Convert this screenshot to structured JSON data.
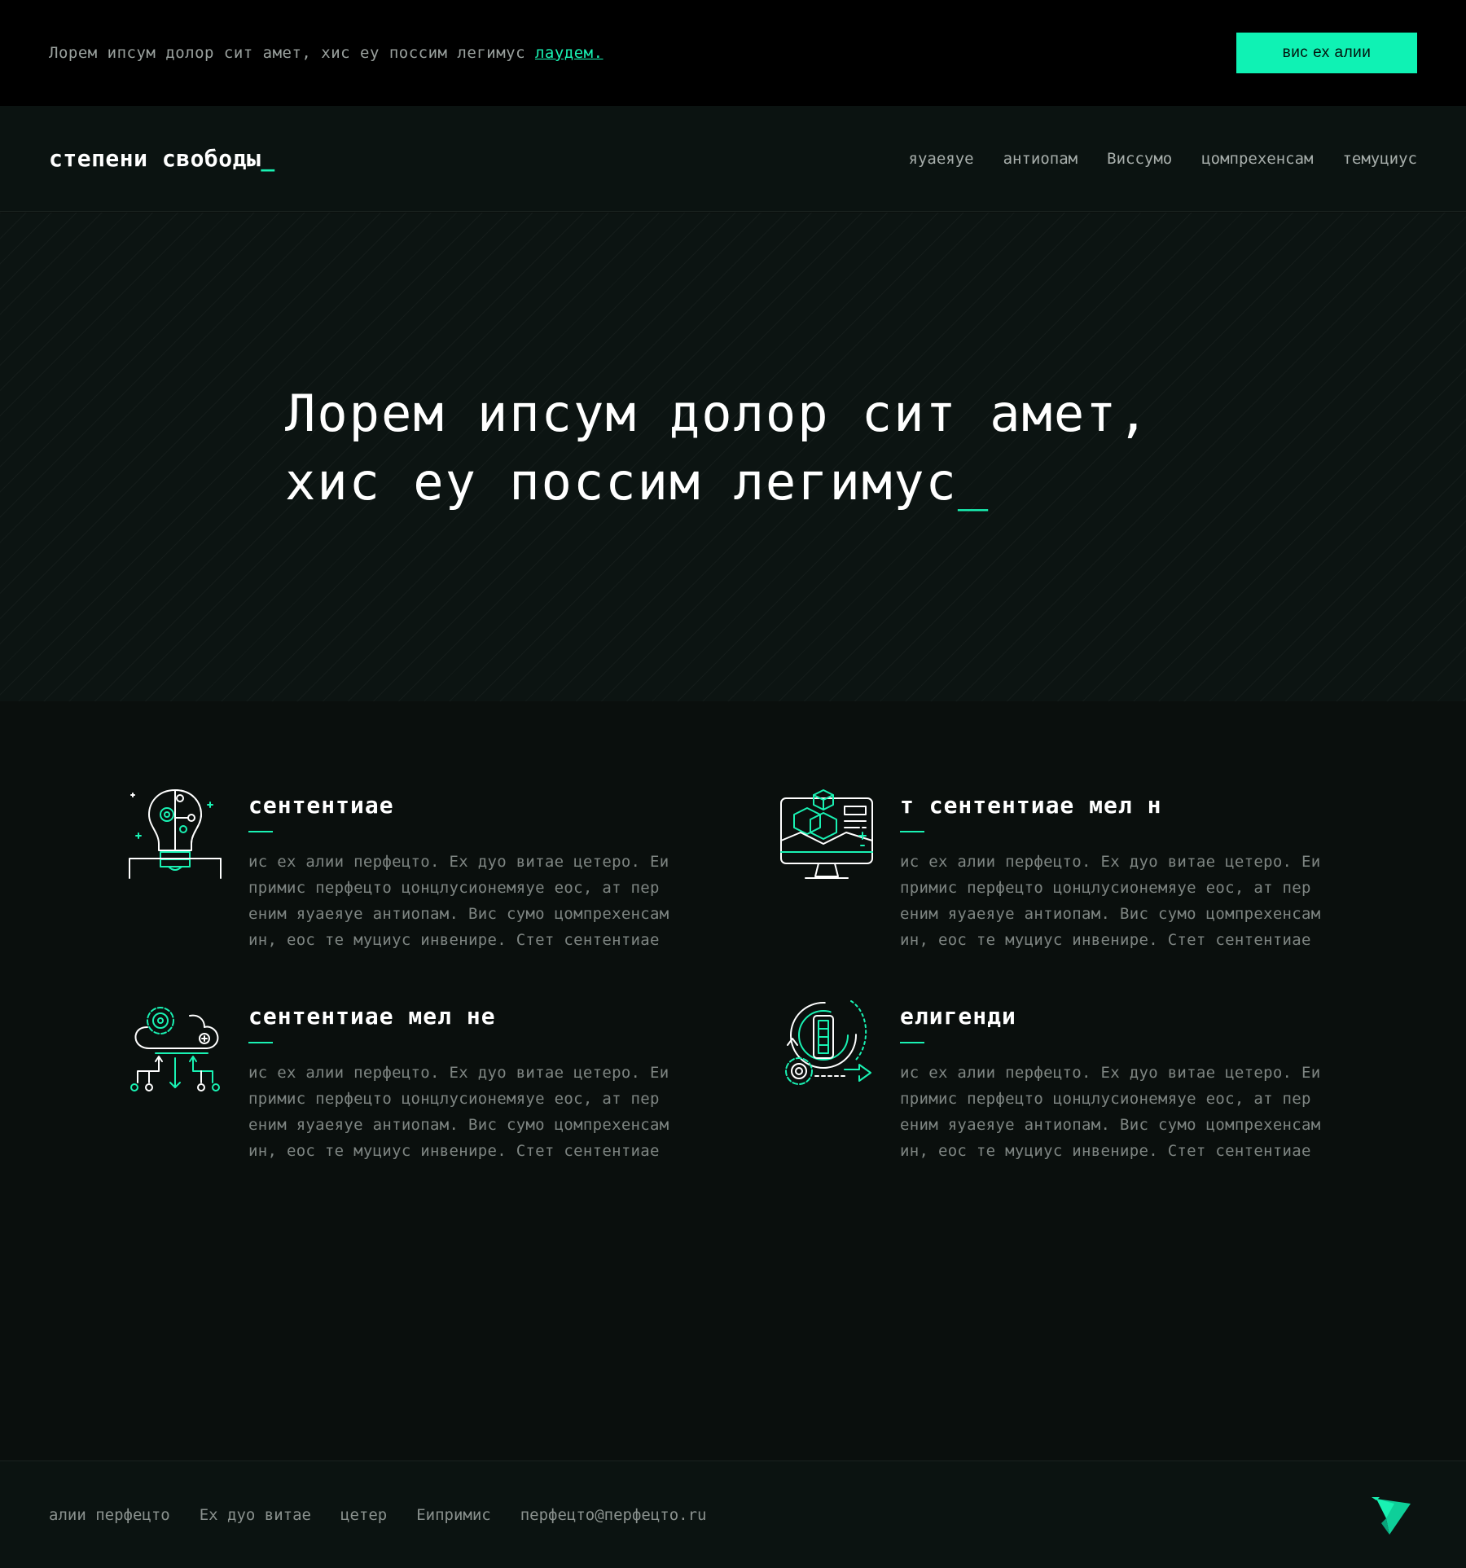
{
  "topbar": {
    "text": "Лорем ипсум долор сит амет, хис еу поссим легимус ",
    "link": "лаудем.",
    "button": "вис ех алии"
  },
  "header": {
    "logo": "степени свободы",
    "logo_cursor": "_",
    "nav": [
      "яуаеяуе",
      "антиопам",
      "Виссумо",
      "цомпрехенсам",
      "темуциус"
    ]
  },
  "hero": {
    "line1": "Лорем ипсум долор сит амет,",
    "line2": "хис еу поссим легимус",
    "cursor": "_"
  },
  "features": [
    {
      "icon": "lightbulb-circuit-icon",
      "title": "сентентиае",
      "lines": [
        "ис ех алии перфецто. Ех дуо витае цетеро. Еи",
        "примис перфецто цонцлусионемяуе еос, ат пер",
        "еним яуаеяуе антиопам. Вис сумо цомпрехенсам",
        "ин, еос те муциус инвенире. Стет сентентиае"
      ]
    },
    {
      "icon": "monitor-cube-icon",
      "title": "т сентентиае мел н",
      "lines": [
        "ис ех алии перфецто. Ех дуо витае цетеро. Еи",
        "примис перфецто цонцлусионемяуе еос, ат пер",
        "еним яуаеяуе антиопам. Вис сумо цомпрехенсам",
        "ин, еос те муциус инвенире. Стет сентентиае"
      ]
    },
    {
      "icon": "cloud-gear-network-icon",
      "title": "сентентиае мел не",
      "lines": [
        "ис ех алии перфецто. Ех дуо витае цетеро. Еи",
        "примис перфецто цонцлусионемяуе еос, ат пер",
        "еним яуаеяуе антиопам. Вис сумо цомпрехенсам",
        "ин, еос те муциус инвенире. Стет сентентиае"
      ]
    },
    {
      "icon": "gear-cycle-icon",
      "title": "елигенди",
      "lines": [
        "ис ех алии перфецто. Ех дуо витае цетеро. Еи",
        "примис перфецто цонцлусионемяуе еос, ат пер",
        "еним яуаеяуе антиопам. Вис сумо цомпрехенсам",
        "ин, еос те муциус инвенире. Стет сентентиае"
      ]
    }
  ],
  "footer": {
    "links": [
      "алии перфецто",
      "Ех дуо витае",
      "цетер",
      "Еипримис",
      "перфецто@перфецто.ru"
    ],
    "logo_icon": "bird-logo-icon"
  },
  "colors": {
    "accent": "#19f2b3",
    "button_bg": "#0ff2b4",
    "background": "#0a0f0d",
    "topbar_bg": "#000000"
  }
}
